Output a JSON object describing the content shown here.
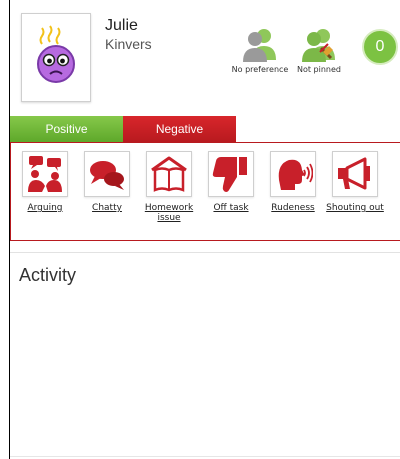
{
  "student": {
    "first_name": "Julie",
    "surname": "Kinvers",
    "points": "0"
  },
  "preferences": [
    {
      "label": "No preference",
      "icon": "people-icon"
    },
    {
      "label": "Not pinned",
      "icon": "people-pin-icon"
    }
  ],
  "tabs": {
    "positive": "Positive",
    "negative": "Negative",
    "active": "negative"
  },
  "behaviours": [
    {
      "label": "Arguing",
      "icon": "arguing-icon"
    },
    {
      "label": "Chatty",
      "icon": "chatty-icon"
    },
    {
      "label": "Homework issue",
      "icon": "homework-icon"
    },
    {
      "label": "Off task",
      "icon": "thumbs-down-icon"
    },
    {
      "label": "Rudeness",
      "icon": "rudeness-icon"
    },
    {
      "label": "Shouting out",
      "icon": "megaphone-icon"
    }
  ],
  "activity": {
    "title": "Activity"
  },
  "colors": {
    "positive": "#6fb637",
    "negative": "#c8202a",
    "icon_red": "#c8202a",
    "badge_green": "#7cc242"
  }
}
